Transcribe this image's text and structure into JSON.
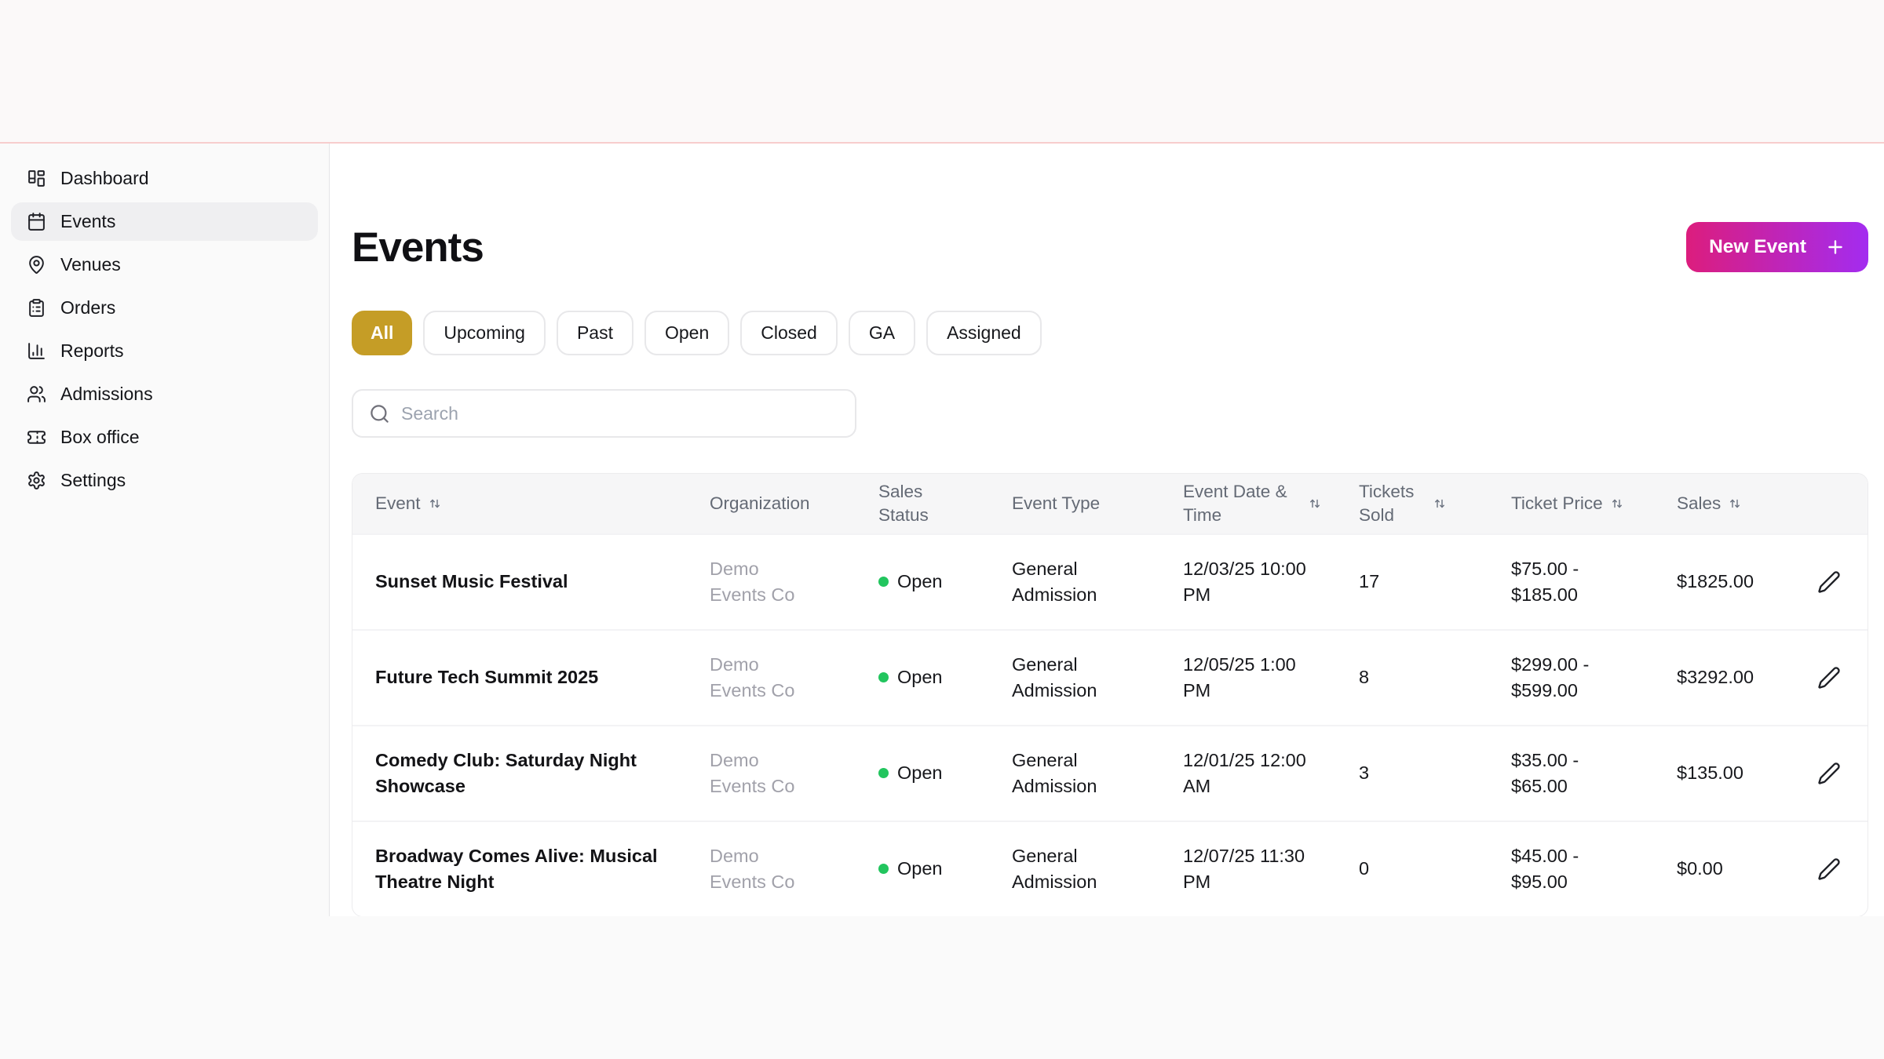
{
  "colors": {
    "accent_gold": "#c59d26",
    "brand_gradient_start": "#dc1d7d",
    "brand_gradient_end": "#a32cf0",
    "status_open_green": "#22c55e",
    "topbar_divider_pink": "#f7cdcd"
  },
  "sidebar": {
    "items": [
      {
        "label": "Dashboard",
        "icon": "dashboard-grid-icon",
        "active": false
      },
      {
        "label": "Events",
        "icon": "calendar-icon",
        "active": true
      },
      {
        "label": "Venues",
        "icon": "map-pin-icon",
        "active": false
      },
      {
        "label": "Orders",
        "icon": "clipboard-list-icon",
        "active": false
      },
      {
        "label": "Reports",
        "icon": "bar-chart-icon",
        "active": false
      },
      {
        "label": "Admissions",
        "icon": "users-icon",
        "active": false
      },
      {
        "label": "Box office",
        "icon": "ticket-icon",
        "active": false
      },
      {
        "label": "Settings",
        "icon": "gear-icon",
        "active": false
      }
    ]
  },
  "header": {
    "title": "Events",
    "new_event_button": "New Event"
  },
  "filters": {
    "selected": "All",
    "options": [
      "All",
      "Upcoming",
      "Past",
      "Open",
      "Closed",
      "GA",
      "Assigned"
    ]
  },
  "search": {
    "placeholder": "Search",
    "value": ""
  },
  "table": {
    "columns": [
      {
        "label": "Event",
        "sortable": true
      },
      {
        "label": "Organization",
        "sortable": false
      },
      {
        "label": "Sales Status",
        "sortable": false
      },
      {
        "label": "Event Type",
        "sortable": false
      },
      {
        "label": "Event Date & Time",
        "sortable": true
      },
      {
        "label": "Tickets Sold",
        "sortable": true
      },
      {
        "label": "Ticket Price",
        "sortable": true
      },
      {
        "label": "Sales",
        "sortable": true
      }
    ],
    "rows": [
      {
        "event": "Sunset Music Festival",
        "organization": "Demo Events Co",
        "sales_status": "Open",
        "event_type": "General Admission",
        "event_datetime": "12/03/25 10:00 PM",
        "tickets_sold": "17",
        "ticket_price": "$75.00 - $185.00",
        "sales": "$1825.00"
      },
      {
        "event": "Future Tech Summit 2025",
        "organization": "Demo Events Co",
        "sales_status": "Open",
        "event_type": "General Admission",
        "event_datetime": "12/05/25 1:00 PM",
        "tickets_sold": "8",
        "ticket_price": "$299.00 - $599.00",
        "sales": "$3292.00"
      },
      {
        "event": "Comedy Club: Saturday Night Showcase",
        "organization": "Demo Events Co",
        "sales_status": "Open",
        "event_type": "General Admission",
        "event_datetime": "12/01/25 12:00 AM",
        "tickets_sold": "3",
        "ticket_price": "$35.00 - $65.00",
        "sales": "$135.00"
      },
      {
        "event": "Broadway Comes Alive: Musical Theatre Night",
        "organization": "Demo Events Co",
        "sales_status": "Open",
        "event_type": "General Admission",
        "event_datetime": "12/07/25 11:30 PM",
        "tickets_sold": "0",
        "ticket_price": "$45.00 - $95.00",
        "sales": "$0.00"
      }
    ]
  }
}
